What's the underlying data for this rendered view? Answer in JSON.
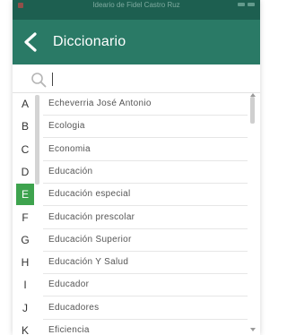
{
  "status_bar": {
    "title": "Ideario de Fidel Castro Ruz"
  },
  "app_bar": {
    "back_icon": "arrow-left-icon",
    "title": "Diccionario"
  },
  "search": {
    "icon": "search-icon",
    "value": "",
    "placeholder": ""
  },
  "index": {
    "letters": [
      "A",
      "B",
      "C",
      "D",
      "E",
      "F",
      "G",
      "H",
      "I",
      "J",
      "K"
    ],
    "active": "E",
    "active_color": "#3ea34e"
  },
  "list": {
    "items": [
      "Echeverria José Antonio",
      "Ecologia",
      "Economia",
      "Educación",
      "Educación especial",
      "Educación prescolar",
      "Educación Superior",
      "Educación Y Salud",
      "Educador",
      "Educadores",
      "Eficiencia"
    ]
  },
  "colors": {
    "app_bar": "#2a7a66",
    "status_bar": "#1d5f50",
    "accent": "#3ea34e"
  }
}
